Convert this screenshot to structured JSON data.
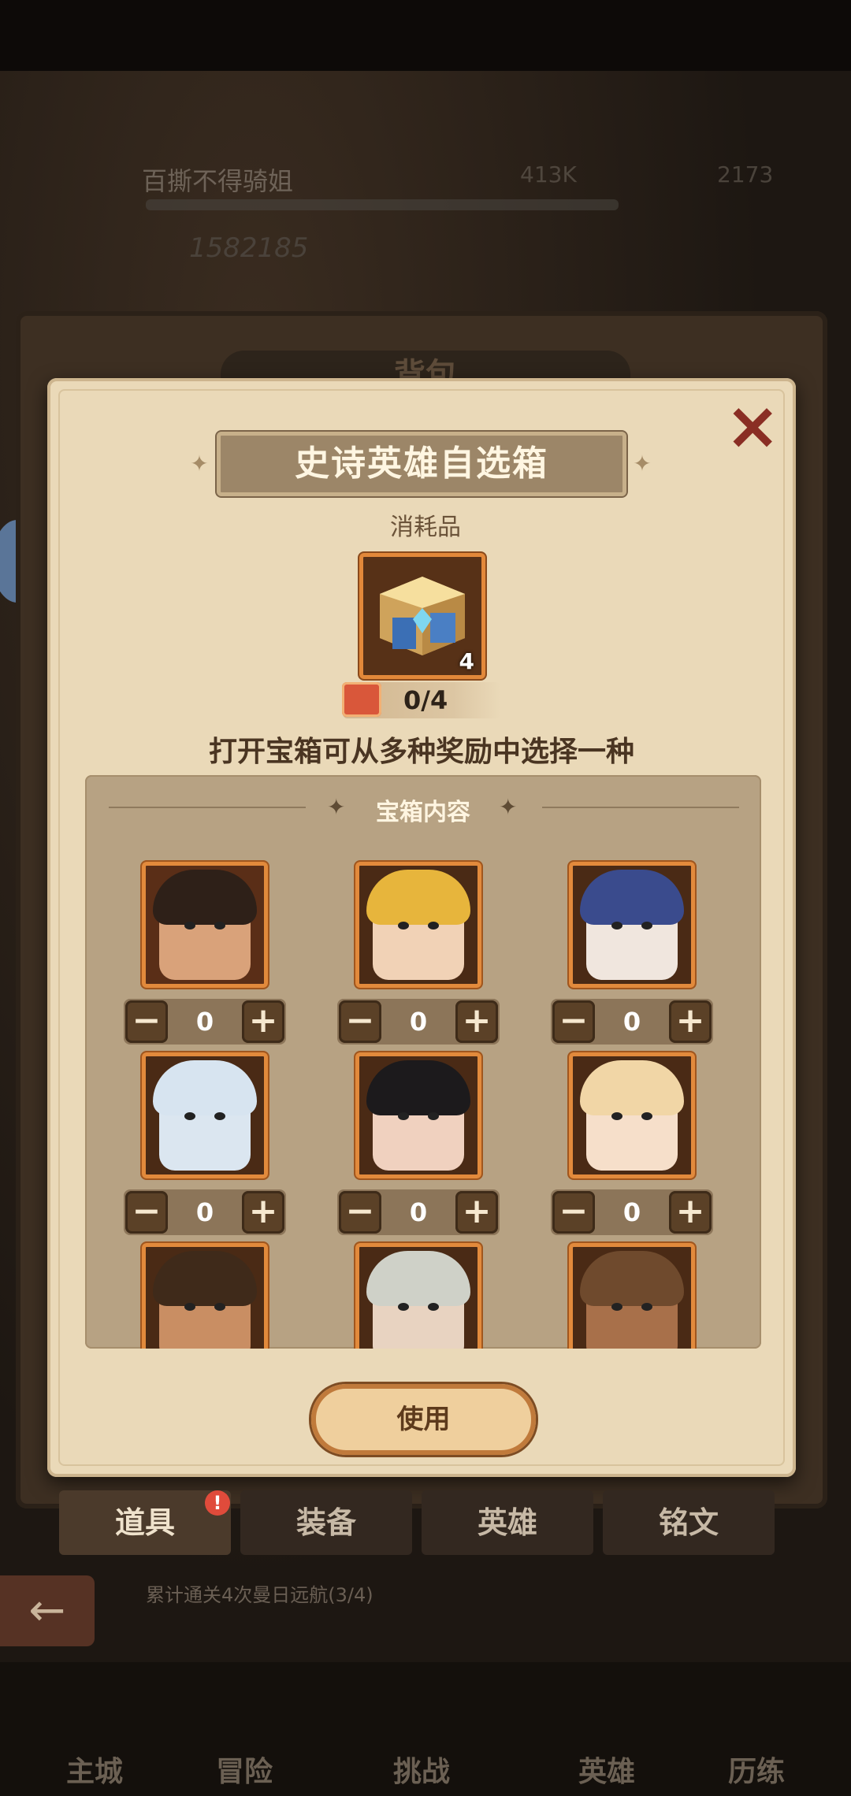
{
  "background": {
    "player_name": "百撕不得骑姐",
    "gold": "413K",
    "gems": "2173",
    "power": "1582185",
    "board_title": "背包",
    "quest_text": "累计通关4次曼日远航(3/4)"
  },
  "popup": {
    "title": "史诗英雄自选箱",
    "item_type": "消耗品",
    "item_count": "4",
    "progress": "0/4",
    "description": "打开宝箱可从多种奖励中选择一种",
    "content_title": "宝箱内容",
    "use_label": "使用",
    "minus_symbol": "−",
    "plus_symbol": "+",
    "heroes": [
      {
        "qty": "0",
        "hair_color": "#2e2018",
        "skin": "#d9a27a",
        "bg": "#5a2e17"
      },
      {
        "qty": "0",
        "hair_color": "#e7b53c",
        "skin": "#f1d2b6",
        "bg": "#4a2a15"
      },
      {
        "qty": "0",
        "hair_color": "#3a4b8d",
        "skin": "#f0e6de",
        "bg": "#4a2a15"
      },
      {
        "qty": "0",
        "hair_color": "#d7e4f0",
        "skin": "#dbe6f0",
        "bg": "#4a2a15"
      },
      {
        "qty": "0",
        "hair_color": "#1c1a1c",
        "skin": "#f0d1bf",
        "bg": "#4a2a15"
      },
      {
        "qty": "0",
        "hair_color": "#f1d6a6",
        "skin": "#f6dfca",
        "bg": "#4a2a15"
      },
      {
        "qty": "",
        "hair_color": "#3f2a1a",
        "skin": "#c98e63",
        "bg": "#4a2a15"
      },
      {
        "qty": "",
        "hair_color": "#cfd1c8",
        "skin": "#e8d3c1",
        "bg": "#4a2a15"
      },
      {
        "qty": "",
        "hair_color": "#6f4a2d",
        "skin": "#a8704a",
        "bg": "#4a2a15"
      }
    ]
  },
  "tabs": [
    {
      "label": "道具",
      "active": true
    },
    {
      "label": "装备",
      "active": false
    },
    {
      "label": "英雄",
      "active": false
    },
    {
      "label": "铭文",
      "active": false
    }
  ],
  "tab_badge": "!",
  "nav": [
    "主城",
    "冒险",
    "挑战",
    "英雄",
    "历练"
  ],
  "colors": {
    "accent": "#e28a3c",
    "panel": "#ead9b8",
    "close": "#8a2e24"
  }
}
